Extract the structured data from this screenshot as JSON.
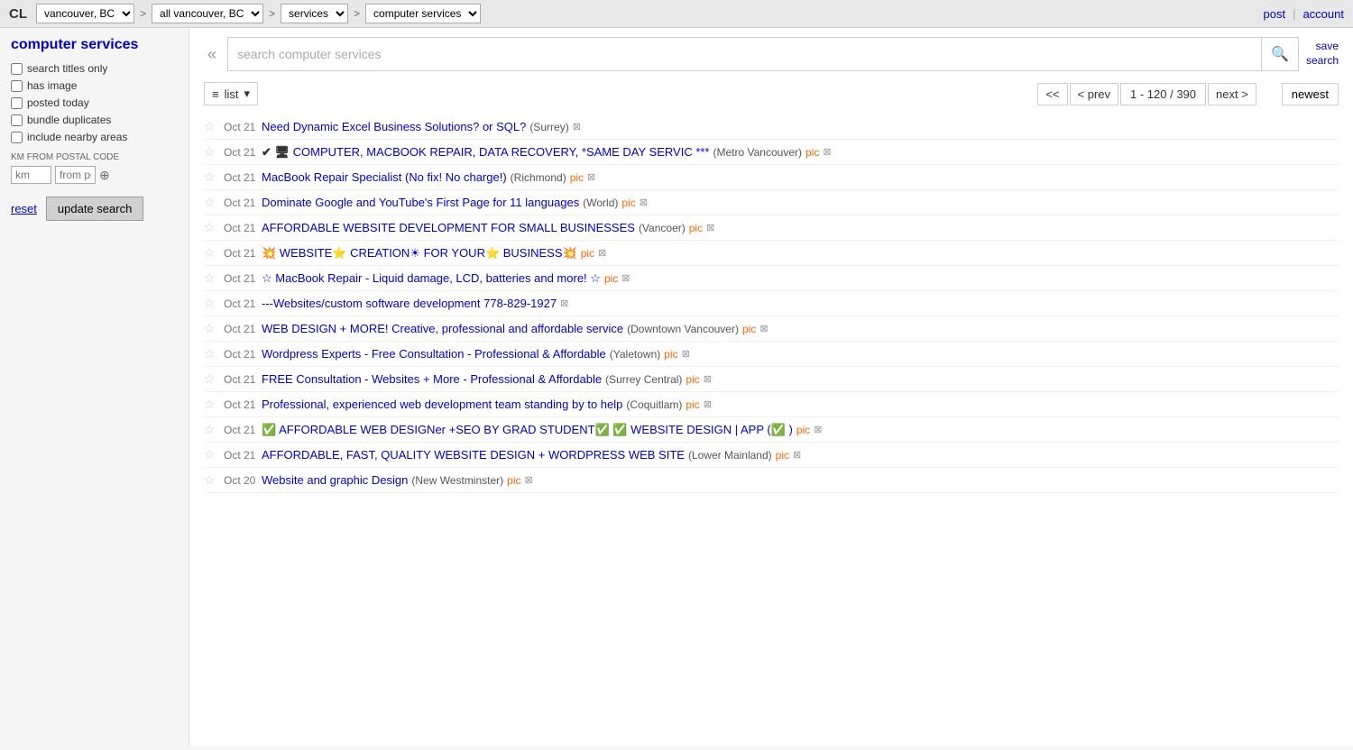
{
  "topbar": {
    "logo": "CL",
    "region": "vancouver, BC",
    "area": "all vancouver, BC",
    "category1": "services",
    "category2": "computer services",
    "post_label": "post",
    "account_label": "account"
  },
  "sidebar": {
    "title": "computer services",
    "filters": {
      "search_titles_only": "search titles only",
      "has_image": "has image",
      "posted_today": "posted today",
      "bundle_duplicates": "bundle duplicates",
      "include_nearby": "include nearby areas"
    },
    "km_label": "KM FROM POSTAL CODE",
    "km_placeholder": "km",
    "postal_placeholder": "from pos",
    "reset_label": "reset",
    "update_label": "update search"
  },
  "search": {
    "placeholder": "search computer services",
    "save_line1": "save",
    "save_line2": "search"
  },
  "controls": {
    "view_label": "list",
    "first_label": "<<",
    "prev_label": "< prev",
    "page_info": "1 - 120 / 390",
    "next_label": "next >",
    "newest_label": "newest"
  },
  "listings": [
    {
      "date": "Oct 21",
      "title": "Need Dynamic Excel Business Solutions? or SQL?",
      "location": "(Surrey)",
      "has_pic": false,
      "verified": false,
      "emoji_prefix": ""
    },
    {
      "date": "Oct 21",
      "title": "COMPUTER, MACBOOK REPAIR, DATA RECOVERY, *SAME DAY SERVIC ***",
      "location": "(Metro Vancouver)",
      "has_pic": true,
      "verified": true,
      "emoji_prefix": "✔ 🖥"
    },
    {
      "date": "Oct 21",
      "title": "MacBook Repair Specialist (No fix! No charge!)",
      "location": "(Richmond)",
      "has_pic": true,
      "verified": false,
      "emoji_prefix": ""
    },
    {
      "date": "Oct 21",
      "title": "Dominate Google and YouTube's First Page for 11 languages",
      "location": "(World)",
      "has_pic": true,
      "verified": false,
      "emoji_prefix": ""
    },
    {
      "date": "Oct 21",
      "title": "AFFORDABLE WEBSITE DEVELOPMENT FOR SMALL BUSINESSES",
      "location": "(Vancoer)",
      "has_pic": true,
      "verified": false,
      "emoji_prefix": ""
    },
    {
      "date": "Oct 21",
      "title": "💥 WEBSITE⭐ CREATION☀ FOR YOUR⭐ BUSINESS💥",
      "location": "",
      "has_pic": true,
      "verified": false,
      "emoji_prefix": ""
    },
    {
      "date": "Oct 21",
      "title": "☆ MacBook Repair - Liquid damage, LCD, batteries and more! ☆",
      "location": "",
      "has_pic": true,
      "verified": false,
      "emoji_prefix": ""
    },
    {
      "date": "Oct 21",
      "title": "---Websites/custom software development 778-829-1927",
      "location": "",
      "has_pic": false,
      "verified": false,
      "emoji_prefix": ""
    },
    {
      "date": "Oct 21",
      "title": "WEB DESIGN + MORE! Creative, professional and affordable service",
      "location": "(Downtown Vancouver)",
      "has_pic": true,
      "verified": false,
      "emoji_prefix": ""
    },
    {
      "date": "Oct 21",
      "title": "Wordpress Experts - Free Consultation - Professional & Affordable",
      "location": "(Yaletown)",
      "has_pic": true,
      "verified": false,
      "emoji_prefix": ""
    },
    {
      "date": "Oct 21",
      "title": "FREE Consultation - Websites + More - Professional & Affordable",
      "location": "(Surrey Central)",
      "has_pic": true,
      "verified": false,
      "emoji_prefix": ""
    },
    {
      "date": "Oct 21",
      "title": "Professional, experienced web development team standing by to help",
      "location": "(Coquitlam)",
      "has_pic": true,
      "verified": false,
      "emoji_prefix": ""
    },
    {
      "date": "Oct 21",
      "title": "✅ AFFORDABLE WEB DESIGNer +SEO BY GRAD STUDENT✅ ✅ WEBSITE DESIGN | APP (✅ )",
      "location": "",
      "has_pic": true,
      "verified": false,
      "emoji_prefix": ""
    },
    {
      "date": "Oct 21",
      "title": "AFFORDABLE, FAST, QUALITY WEBSITE DESIGN + WORDPRESS WEB SITE",
      "location": "(Lower Mainland)",
      "has_pic": true,
      "verified": false,
      "emoji_prefix": ""
    },
    {
      "date": "Oct 20",
      "title": "Website and graphic Design",
      "location": "(New Westminster)",
      "has_pic": true,
      "verified": false,
      "emoji_prefix": ""
    }
  ]
}
